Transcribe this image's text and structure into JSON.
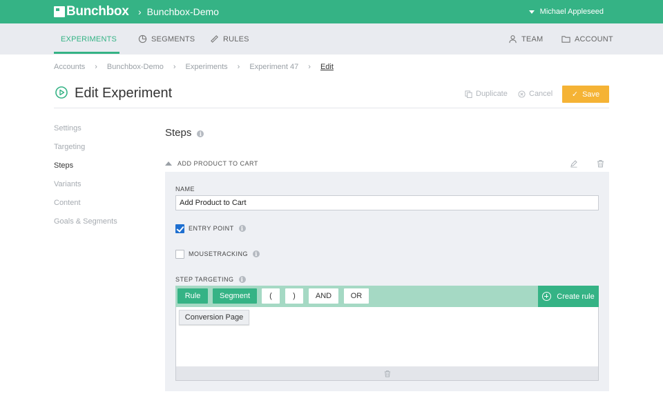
{
  "app": {
    "brand": "Bunchbox",
    "project": "Bunchbox-Demo",
    "user": "Michael Appleseed"
  },
  "nav": {
    "experiments": "EXPERIMENTS",
    "segments": "SEGMENTS",
    "rules": "RULES",
    "team": "TEAM",
    "account": "ACCOUNT"
  },
  "breadcrumb": [
    "Accounts",
    "Bunchbox-Demo",
    "Experiments",
    "Experiment 47",
    "Edit"
  ],
  "page": {
    "title": "Edit Experiment",
    "duplicate": "Duplicate",
    "cancel": "Cancel",
    "save": "Save"
  },
  "sidebar": {
    "items": [
      {
        "label": "Settings",
        "active": false
      },
      {
        "label": "Targeting",
        "active": false
      },
      {
        "label": "Steps",
        "active": true
      },
      {
        "label": "Variants",
        "active": false
      },
      {
        "label": "Content",
        "active": false
      },
      {
        "label": "Goals & Segments",
        "active": false
      }
    ]
  },
  "steps": {
    "title": "Steps",
    "step": {
      "header": "ADD PRODUCT TO CART",
      "name_label": "NAME",
      "name_value": "Add Product to Cart",
      "entry_point_label": "ENTRY POINT",
      "entry_point_checked": true,
      "mousetracking_label": "MOUSETRACKING",
      "mousetracking_checked": false,
      "targeting_label": "STEP TARGETING",
      "toolbar": {
        "rule": "Rule",
        "segment": "Segment",
        "open_paren": "(",
        "close_paren": ")",
        "and": "AND",
        "or": "OR",
        "create_rule": "Create rule"
      },
      "rule_chip": "Conversion Page"
    }
  },
  "colors": {
    "brand_green": "#35b385",
    "save_orange": "#f5b335",
    "checkbox_blue": "#1e6fd0"
  },
  "icons": {
    "experiments": "flask-icon",
    "segments": "pie-chart-icon",
    "rules": "ruler-icon",
    "team": "user-icon",
    "account": "folder-icon",
    "title": "play-circle-icon",
    "duplicate": "copy-icon",
    "cancel": "x-circle-icon",
    "edit": "pencil-icon",
    "delete": "trash-icon",
    "info": "info-icon",
    "create": "plus-circle-icon"
  }
}
